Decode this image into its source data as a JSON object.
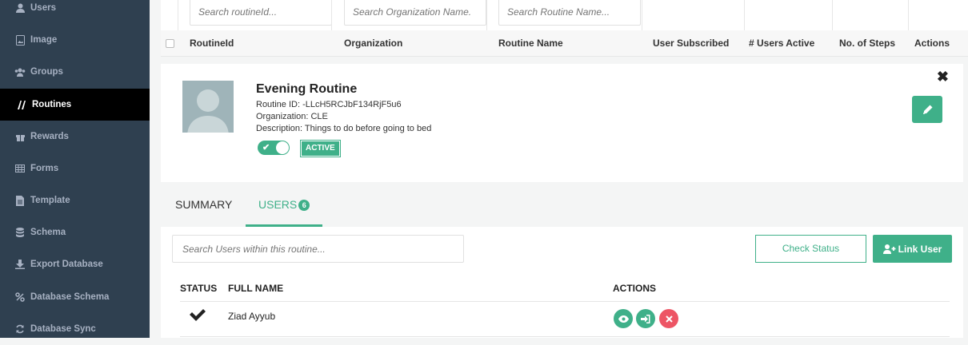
{
  "sidebar": {
    "items": [
      {
        "label": "Users",
        "icon": "user-icon"
      },
      {
        "label": "Image",
        "icon": "image-icon"
      },
      {
        "label": "Groups",
        "icon": "groups-icon"
      },
      {
        "label": "Routines",
        "icon": "routines-icon",
        "active": true
      },
      {
        "label": "Rewards",
        "icon": "gift-icon"
      },
      {
        "label": "Forms",
        "icon": "table-icon"
      },
      {
        "label": "Template",
        "icon": "file-icon"
      },
      {
        "label": "Schema",
        "icon": "database-icon"
      },
      {
        "label": "Export Database",
        "icon": "download-icon"
      },
      {
        "label": "Database Schema",
        "icon": "percent-icon"
      },
      {
        "label": "Database Sync",
        "icon": "sync-icon"
      }
    ]
  },
  "filters": {
    "routine_id_placeholder": "Search routineId...",
    "organization_placeholder": "Search Organization Name.",
    "routine_name_placeholder": "Search Routine Name..."
  },
  "table": {
    "headers": {
      "routine_id": "RoutineId",
      "organization": "Organization",
      "routine_name": "Routine Name",
      "user_subscribed": "User Subscribed",
      "users_active": "# Users Active",
      "steps": "No. of Steps",
      "actions": "Actions"
    }
  },
  "routine": {
    "title": "Evening Routine",
    "id_line": "Routine ID: -LLcH5RCJbF134RjF5u6",
    "org_line": "Organization: CLE",
    "desc_line": "Description: Things to do before going to bed",
    "status_badge": "ACTIVE",
    "toggle_on": true
  },
  "tabs": {
    "summary": "SUMMARY",
    "users": "USERS",
    "users_count": "6"
  },
  "users_panel": {
    "search_placeholder": "Search Users within this routine...",
    "check_status": "Check Status",
    "link_user": "Link User",
    "col_status": "STATUS",
    "col_full_name": "FULL NAME",
    "col_actions": "ACTIONS",
    "rows": [
      {
        "name": "Ziad Ayyub",
        "status": "check-icon"
      }
    ]
  },
  "colors": {
    "accent": "#3fb089",
    "danger": "#ed5565",
    "sidebar_bg": "#2f4050"
  }
}
